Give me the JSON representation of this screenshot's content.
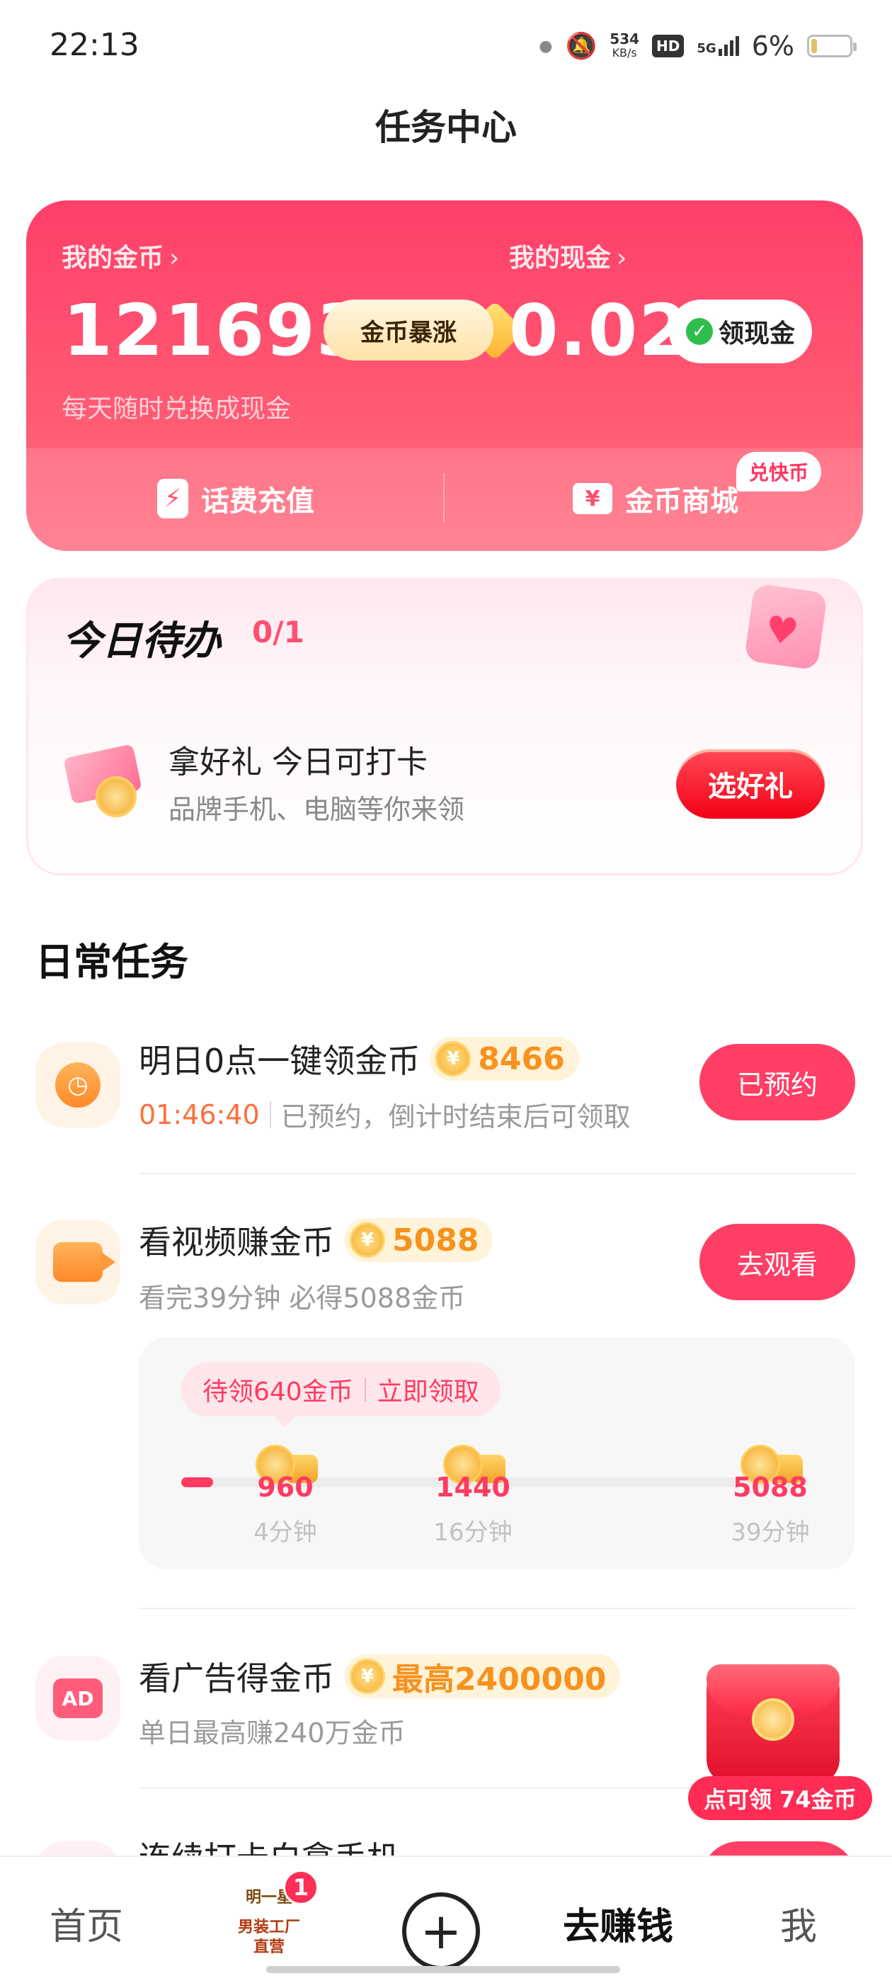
{
  "status_bar": {
    "time": "22:13",
    "net_speed_value": "534",
    "net_speed_unit": "KB/s",
    "hd": "HD",
    "network": "5G",
    "battery": "6%"
  },
  "page_title": "任务中心",
  "wallet": {
    "coins_label": "我的金币",
    "coins_value": "121693",
    "coins_boost_label": "金币暴涨",
    "cash_label": "我的现金",
    "cash_value": "0.02",
    "claim_cash_label": "领现金",
    "subtitle": "每天随时兑换成现金",
    "recharge_label": "话费充值",
    "shop_label": "金币商城",
    "shop_badge": "兑快币",
    "arrow": "›"
  },
  "today_todo": {
    "title": "今日待办",
    "count": "0/1",
    "item_title": "拿好礼 今日可打卡",
    "item_subtitle": "品牌手机、电脑等你来领",
    "button_label": "选好礼"
  },
  "daily_tasks": {
    "section_title": "日常任务",
    "tasks": [
      {
        "title": "明日0点一键领金币",
        "coins": "8466",
        "countdown": "01:46:40",
        "subtitle": "已预约，倒计时结束后可领取",
        "button_label": "已预约",
        "icon": "clock-icon"
      },
      {
        "title": "看视频赚金币",
        "coins": "5088",
        "subtitle": "看完39分钟 必得5088金币",
        "button_label": "去观看",
        "icon": "video-icon"
      },
      {
        "title": "看广告得金币",
        "coins": "最高2400000",
        "subtitle": "单日最高赚240万金币",
        "icon": "ad-icon",
        "icon_text": "AD"
      },
      {
        "title": "连续打卡白拿手机"
      }
    ],
    "video_progress": {
      "pending_label": "待领640金币",
      "claim_label": "立即领取",
      "progress_fraction": 0.03,
      "milestones": [
        {
          "value": "960",
          "label": "4分钟"
        },
        {
          "value": "1440",
          "label": "16分钟"
        },
        {
          "value": "5088",
          "label": "39分钟"
        }
      ]
    },
    "red_packet_label": "点可领 74金币"
  },
  "bottom_nav": {
    "home": "首页",
    "promo_line1": "明一星",
    "promo_line2": "男装工厂直营",
    "promo_badge": "1",
    "plus": "+",
    "earn": "去赚钱",
    "me": "我"
  },
  "colors": {
    "accent": "#ff3f66",
    "coin": "#f6921e",
    "countdown": "#ff6f3c"
  }
}
